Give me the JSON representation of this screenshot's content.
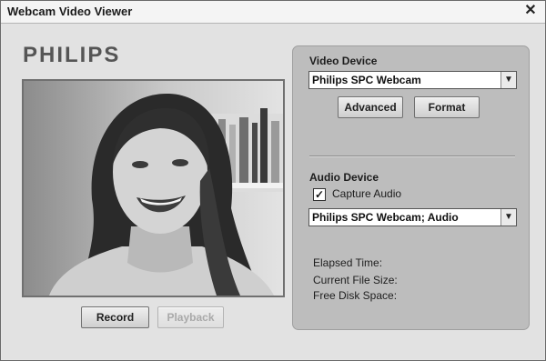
{
  "window": {
    "title": "Webcam Video Viewer",
    "close_glyph": "✕"
  },
  "brand": {
    "logo_text": "PHILIPS"
  },
  "actions": {
    "record_label": "Record",
    "playback_label": "Playback"
  },
  "video_device": {
    "label": "Video Device",
    "selected": "Philips SPC Webcam",
    "advanced_label": "Advanced",
    "format_label": "Format"
  },
  "audio_device": {
    "label": "Audio Device",
    "capture_audio_label": "Capture Audio",
    "capture_audio_checked": true,
    "check_glyph": "✓",
    "selected": "Philips SPC Webcam; Audio"
  },
  "status": {
    "elapsed_time_label": "Elapsed Time:",
    "file_size_label": "Current File Size:",
    "disk_space_label": "Free Disk Space:"
  },
  "icons": {
    "dropdown": "chevron-down-icon",
    "close": "close-icon",
    "check": "check-icon"
  }
}
